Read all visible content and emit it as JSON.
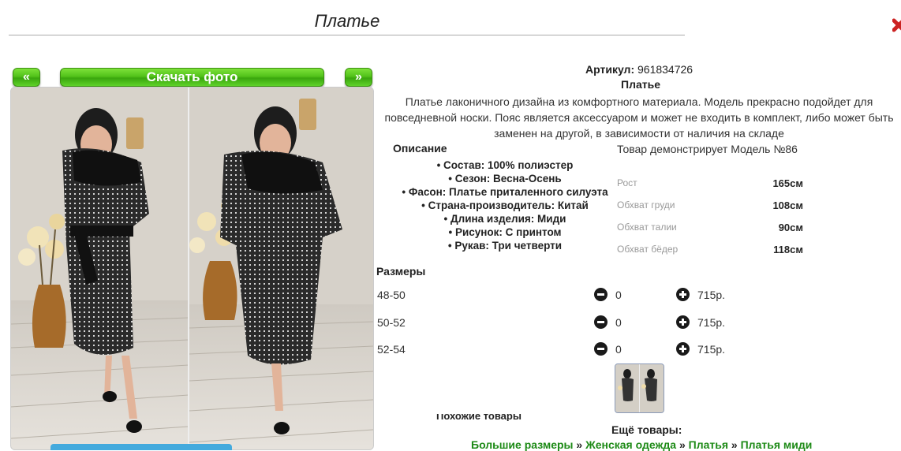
{
  "page": {
    "title": "Платье"
  },
  "gallery": {
    "prev_label": "«",
    "next_label": "»",
    "download_label": "Скачать фото"
  },
  "product": {
    "article_label": "Артикул:",
    "article_value": "961834726",
    "name": "Платье",
    "description": "Платье лаконичного дизайна из комфортного материала. Модель прекрасно подойдет для повседневной носки. Пояс является аксессуаром и может не входить в комплект, либо может быть заменен на другой, в зависимости от наличия на складе",
    "description_heading": "Описание",
    "specs": [
      "Состав: 100% полиэстер",
      "Сезон: Весна-Осень",
      "Фасон: Платье приталенного силуэта",
      "Страна-производитель: Китай",
      "Длина изделия: Миди",
      "Рисунок: С принтом",
      "Рукав: Три четверти"
    ]
  },
  "model": {
    "heading": "Товар демонстрирует Модель №86",
    "measurements": [
      {
        "label": "Рост",
        "value": "165см"
      },
      {
        "label": "Обхват груди",
        "value": "108см"
      },
      {
        "label": "Обхват талии",
        "value": "90см"
      },
      {
        "label": "Обхват бёдер",
        "value": "118см"
      }
    ]
  },
  "sizes": {
    "heading": "Размеры",
    "rows": [
      {
        "size": "48-50",
        "qty": "0",
        "price": "715р."
      },
      {
        "size": "50-52",
        "qty": "0",
        "price": "715р."
      },
      {
        "size": "52-54",
        "qty": "0",
        "price": "715р."
      }
    ]
  },
  "footer": {
    "similar_heading": "Похожие товары",
    "more_heading": "Ещё товары:",
    "breadcrumb": [
      "Большие размеры",
      "Женская одежда",
      "Платья",
      "Платья миди"
    ],
    "breadcrumb_separator": "»"
  },
  "colors": {
    "accent_green": "#52c21a",
    "link_green": "#1d8a16",
    "close_red": "#cc2222"
  },
  "icons": {
    "minus": "minus-circle-icon",
    "plus": "plus-circle-icon"
  }
}
